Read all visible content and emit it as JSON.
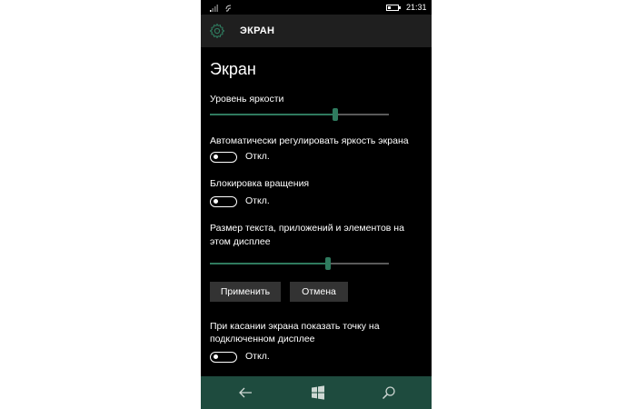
{
  "status_bar": {
    "time": "21:31",
    "battery_level": 0.25
  },
  "title_bar": {
    "title": "ЭКРАН",
    "icon": "gear-icon"
  },
  "section": {
    "heading": "Экран"
  },
  "brightness": {
    "label": "Уровень яркости",
    "value": 0.7
  },
  "auto_brightness": {
    "label": "Автоматически регулировать яркость экрана",
    "toggle_text": "Откл.",
    "on": false
  },
  "rotation_lock": {
    "label": "Блокировка вращения",
    "toggle_text": "Откл.",
    "on": false
  },
  "text_size": {
    "label_line1": "Размер текста, приложений и элементов на",
    "label_line2": "этом дисплее",
    "value": 0.66
  },
  "buttons": {
    "apply": "Применить",
    "cancel": "Отмена"
  },
  "touch_point": {
    "label_line1": "При касании экрана показать точку на",
    "label_line2": "подключенном дисплее",
    "toggle_text": "Откл.",
    "on": false
  },
  "colors": {
    "accent": "#2f7a5e",
    "navbar": "#1e4b3e",
    "titlebar": "#1f1f1f",
    "background": "#000000"
  },
  "navbar": {
    "icons": [
      "back-icon",
      "windows-icon",
      "search-icon"
    ]
  }
}
